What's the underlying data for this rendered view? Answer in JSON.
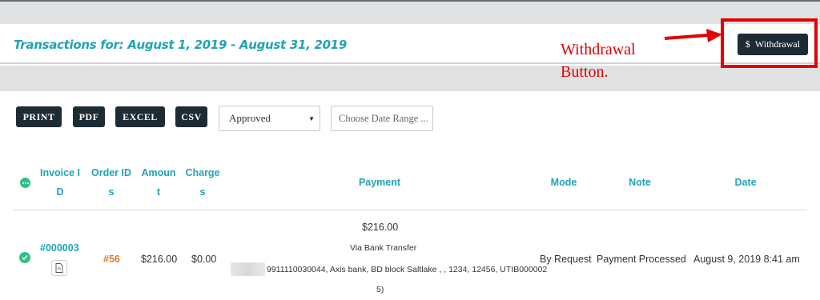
{
  "header": {
    "title": "Transactions for: August 1, 2019 - August 31, 2019",
    "withdraw_button": {
      "icon": "dollar-icon",
      "symbol": "$",
      "label": "Withdrawal"
    }
  },
  "annotation": {
    "label": "Withdrawal Button.",
    "color": "#e30000"
  },
  "toolbar": {
    "buttons": [
      "PRINT",
      "PDF",
      "EXCEL",
      "CSV"
    ],
    "status_select": {
      "value": "Approved",
      "icon": "caret-down-icon"
    },
    "date_range": {
      "placeholder": "Choose Date Range ..."
    }
  },
  "table": {
    "columns": [
      {
        "line1": "Invoice I",
        "line2": "D"
      },
      {
        "line1": "Order ID",
        "line2": "s"
      },
      {
        "line1": "Amoun",
        "line2": "t"
      },
      {
        "line1": "Charge",
        "line2": "s"
      },
      {
        "line1": "Payment",
        "line2": ""
      },
      {
        "line1": "Mode",
        "line2": ""
      },
      {
        "line1": "Note",
        "line2": ""
      },
      {
        "line1": "Date",
        "line2": ""
      }
    ],
    "rows": [
      {
        "invoice_id": "#000003",
        "order_id": "#56",
        "amount": "$216.00",
        "charges": "$0.00",
        "payment_amount": "$216.00",
        "payment_method": "Via Bank Transfer",
        "payment_details": "9911110030044, Axis bank, BD block Saltlake , , 1234, 12456, UTIB000002",
        "payment_details_end": "5)",
        "mode": "By Request",
        "note": "Payment Processed",
        "date": "August 9, 2019 8:41 am"
      }
    ]
  },
  "colors": {
    "accent": "#1fa3b8",
    "dark_button": "#1d2b35",
    "order_link": "#e07a2a",
    "status_green": "#2ec286"
  }
}
